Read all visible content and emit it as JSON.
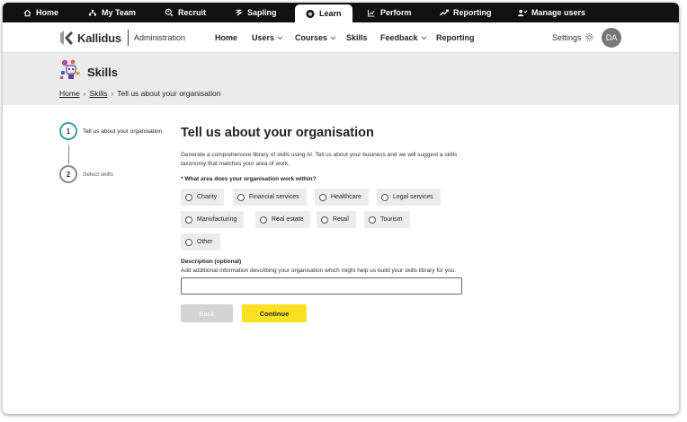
{
  "topbar": {
    "items": [
      {
        "label": "Home",
        "icon": "home-icon"
      },
      {
        "label": "My Team",
        "icon": "team-icon"
      },
      {
        "label": "Recruit",
        "icon": "recruit-icon"
      },
      {
        "label": "Sapling",
        "icon": "sapling-icon"
      },
      {
        "label": "Learn",
        "icon": "learn-icon",
        "active": true
      },
      {
        "label": "Perform",
        "icon": "perform-icon"
      },
      {
        "label": "Reporting",
        "icon": "reporting-icon"
      },
      {
        "label": "Manage users",
        "icon": "manage-users-icon"
      }
    ]
  },
  "header": {
    "brand": "Kallidus",
    "section": "Administration",
    "nav": [
      {
        "label": "Home",
        "has_dropdown": false
      },
      {
        "label": "Users",
        "has_dropdown": true
      },
      {
        "label": "Courses",
        "has_dropdown": true
      },
      {
        "label": "Skills",
        "has_dropdown": false
      },
      {
        "label": "Feedback",
        "has_dropdown": true
      },
      {
        "label": "Reporting",
        "has_dropdown": false
      }
    ],
    "settings_label": "Settings",
    "avatar_initials": "DA"
  },
  "page": {
    "title": "Skills",
    "breadcrumb": [
      "Home",
      "Skills",
      "Tell us about your organisation"
    ]
  },
  "stepper": {
    "steps": [
      {
        "number": "1",
        "label": "Tell us about your organisation",
        "active": true
      },
      {
        "number": "2",
        "label": "Select skills",
        "active": false
      }
    ]
  },
  "form": {
    "heading": "Tell us about your organisation",
    "intro": "Generate a comprehensive library of skills using AI. Tell us about your business and we will suggest a skills taxonomy that matches your area of work.",
    "question": "* What area does your organisation work within?",
    "options": [
      "Charity",
      "Financial services",
      "Healthcare",
      "Legal services",
      "Manufacturing",
      "Real estate",
      "Retail",
      "Tourism",
      "Other"
    ],
    "description_label": "Description (optional)",
    "description_help": "Add additional information describing your organisation which might help us build your skills library for you.",
    "description_value": "",
    "back_label": "Back",
    "continue_label": "Continue"
  },
  "colors": {
    "topbar": "#111111",
    "accent_step": "#36a59c",
    "continue_button": "#fbe124",
    "back_button_disabled": "#d3d3d3",
    "page_band": "#ebebeb"
  }
}
